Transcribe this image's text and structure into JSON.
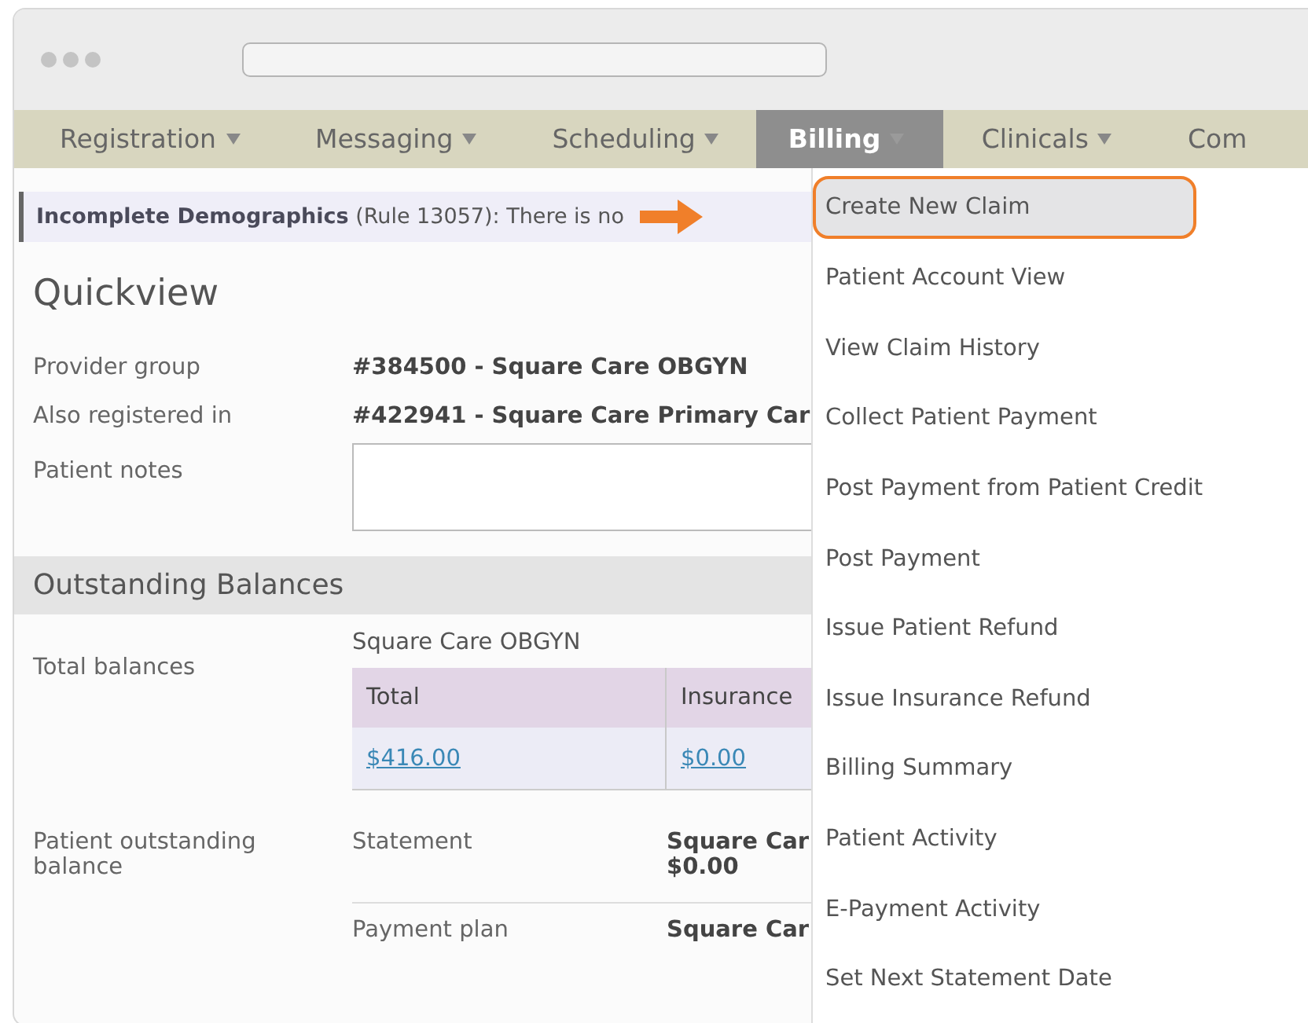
{
  "nav": {
    "tabs": [
      {
        "label": "Registration",
        "caret": true,
        "selected": false
      },
      {
        "label": "Messaging",
        "caret": true,
        "selected": false
      },
      {
        "label": "Scheduling",
        "caret": true,
        "selected": false
      },
      {
        "label": "Billing",
        "caret": true,
        "selected": true
      },
      {
        "label": "Clinicals",
        "caret": true,
        "selected": false
      },
      {
        "label": "Com",
        "caret": false,
        "selected": false
      }
    ]
  },
  "alert": {
    "text": "**Incomplete Demographics** (Rule 13057): There is no"
  },
  "quickview": {
    "title": "Quickview",
    "fields": [
      {
        "label": "Provider group",
        "value": "#384500 - Square Care OBGYN"
      },
      {
        "label": "Also registered in",
        "value": "#422941 - Square Care Primary Car"
      }
    ],
    "notes": {
      "label": "Patient notes"
    }
  },
  "balances": {
    "title": "Outstanding Balances",
    "total": {
      "label": "Total balances",
      "group": "Square Care OBGYN",
      "columns": [
        "Total",
        "Insurance"
      ],
      "values": [
        "$416.00",
        "$0.00"
      ]
    },
    "patient": {
      "label": "Patient outstanding balance",
      "rows": [
        {
          "label": "Statement",
          "value": "Square Car",
          "amount": "$0.00"
        },
        {
          "label": "Payment plan",
          "value": "Square Car"
        }
      ]
    }
  },
  "menu": {
    "items": [
      {
        "label": "Create New Claim",
        "selected": true
      },
      {
        "label": "Patient Account View",
        "selected": false
      },
      {
        "label": "View Claim History",
        "selected": false
      },
      {
        "label": "Collect Patient Payment",
        "selected": false
      },
      {
        "label": "Post Payment from Patient Credit",
        "selected": false
      },
      {
        "label": "Post Payment",
        "selected": false
      },
      {
        "label": "Issue Patient Refund",
        "selected": false
      },
      {
        "label": "Issue Insurance Refund",
        "selected": false
      },
      {
        "label": "Billing Summary",
        "selected": false
      },
      {
        "label": "Patient Activity",
        "selected": false
      },
      {
        "label": "E-Payment Activity",
        "selected": false
      },
      {
        "label": "Set Next Statement Date",
        "selected": false
      }
    ]
  }
}
